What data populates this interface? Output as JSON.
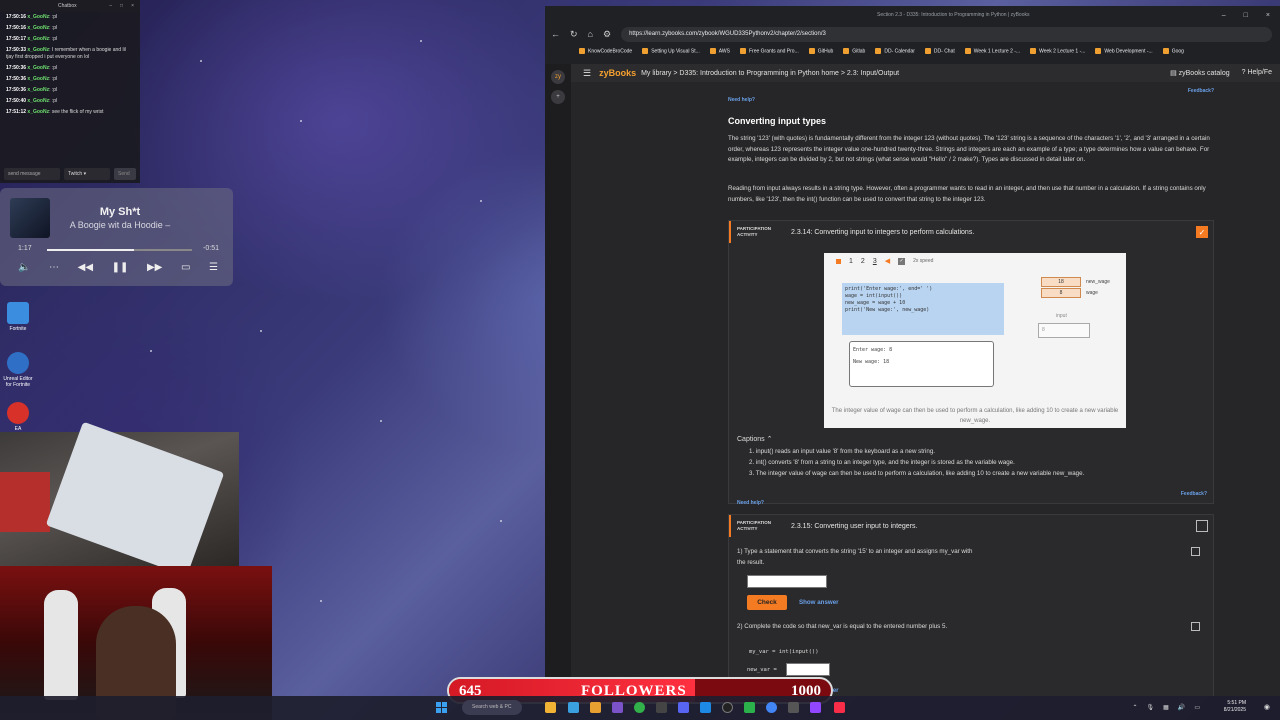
{
  "chat": {
    "title": "Chatbox",
    "messages": [
      {
        "time": "17:50:16",
        "user": "x_GooNz",
        "text": ":pl"
      },
      {
        "time": "17:50:16",
        "user": "x_GooNz",
        "text": ":pl"
      },
      {
        "time": "17:50:17",
        "user": "x_GooNz",
        "text": ":pl"
      },
      {
        "time": "17:50:33",
        "user": "x_GooNz",
        "text": "I remember when a boogie and lil tjay first dropped i put everyone on lol"
      },
      {
        "time": "17:50:36",
        "user": "x_GooNz",
        "text": ":pl"
      },
      {
        "time": "17:50:36",
        "user": "x_GooNz",
        "text": ":pl"
      },
      {
        "time": "17:50:36",
        "user": "x_GooNz",
        "text": ":pl"
      },
      {
        "time": "17:50:40",
        "user": "x_GooNz",
        "text": ":pl"
      },
      {
        "time": "17:51:12",
        "user": "x_GooNz",
        "text": "see the flick of my wrist"
      }
    ],
    "input_placeholder": "send message",
    "platform": "Twitch",
    "send_label": "Send"
  },
  "player": {
    "title": "My Sh*t",
    "artist": "A Boogie wit da Hoodie –",
    "elapsed": "1:17",
    "remaining": "-0:51",
    "progress": 0.6
  },
  "desktop_icons": [
    {
      "label": "Fortnite"
    },
    {
      "label": "Unreal Editor for Fortnite"
    },
    {
      "label": "EA"
    }
  ],
  "browser": {
    "tab_title": "Section 2.3 - D335: Introduction to Programming in Python | zyBooks",
    "url": "https://learn.zybooks.com/zybook/WGUD335Pythonv2/chapter/2/section/3",
    "bookmarks": [
      "KnowCodeBroCode",
      "Setting Up Visual St...",
      "AWS",
      "Free Grants and Pro...",
      "GitHub",
      "Gitlab",
      "DD- Calendar",
      "DD- Chat",
      "Week 1 Lecture 2 -...",
      "Week 2 Lecture 1 -...",
      "Web Development -...",
      "Goog"
    ]
  },
  "zybooks": {
    "logo": "zyBooks",
    "breadcrumb": "My library > D335: Introduction to Programming in Python home > 2.3: Input/Output",
    "catalog": "zyBooks catalog",
    "help": "Help/Fe",
    "need_help": "Need help?",
    "feedback": "Feedback?",
    "section_title": "Converting input types",
    "para1": "The string '123' (with quotes) is fundamentally different from the integer 123 (without quotes). The '123' string is a sequence of the characters '1', '2', and '3' arranged in a certain order, whereas 123 represents the integer value one-hundred twenty-three. Strings and integers are each an example of a type; a type determines how a value can behave. For example, integers can be divided by 2, but not strings (what sense would \"Hello\" / 2 make?). Types are discussed in detail later on.",
    "para2": "Reading from input always results in a string type. However, often a programmer wants to read in an integer, and then use that number in a calculation. If a string contains only numbers, like '123', then the int() function can be used to convert that string to the integer 123.",
    "pa_tag": "PARTICIPATION ACTIVITY",
    "activity1": {
      "title": "2.3.14: Converting input to integers to perform calculations.",
      "steps": [
        "1",
        "2",
        "3"
      ],
      "speed": "2x speed",
      "code": [
        "print('Enter wage:', end=' ')",
        "wage = int(input())",
        "",
        "new_wage = wage + 10",
        "print('New wage:', new_wage)"
      ],
      "output": [
        "Enter wage: 8",
        "New wage: 18"
      ],
      "vars": [
        {
          "value": "18",
          "name": "new_wage"
        },
        {
          "value": "8",
          "name": "wage"
        }
      ],
      "input_label": "input",
      "input_value": "8",
      "caption": "The integer value of wage can then be used to perform a calculation, like adding 10 to create a new variable new_wage.",
      "captions_label": "Captions",
      "captions": [
        "1. input() reads an input value '8' from the keyboard as a new string.",
        "2. int() converts '8' from a string to an integer type, and the integer is stored as the variable wage.",
        "3. The integer value of wage can then be used to perform a calculation, like adding 10 to create a new variable new_wage."
      ]
    },
    "activity2": {
      "title": "2.3.15: Converting user input to integers.",
      "q1": "1)  Type a statement that converts the string '15' to an integer and assigns my_var with the result.",
      "q2": "2)  Complete the code so that new_var is equal to the entered number plus 5.",
      "code_line1": "my_var = int(input())",
      "code_line2": "new_var = ",
      "check_label": "Check",
      "show_answer": "Show answer"
    }
  },
  "followers": {
    "current": "645",
    "label": "FOLLOWERS",
    "goal": "1000",
    "fraction": 0.645
  },
  "taskbar": {
    "search": "Search web & PC",
    "time": "5:51 PM",
    "date": "8/21/2025"
  },
  "colors": {
    "accent": "#f57b23",
    "link": "#6aa0e8",
    "follower_red": "#d41a25"
  }
}
